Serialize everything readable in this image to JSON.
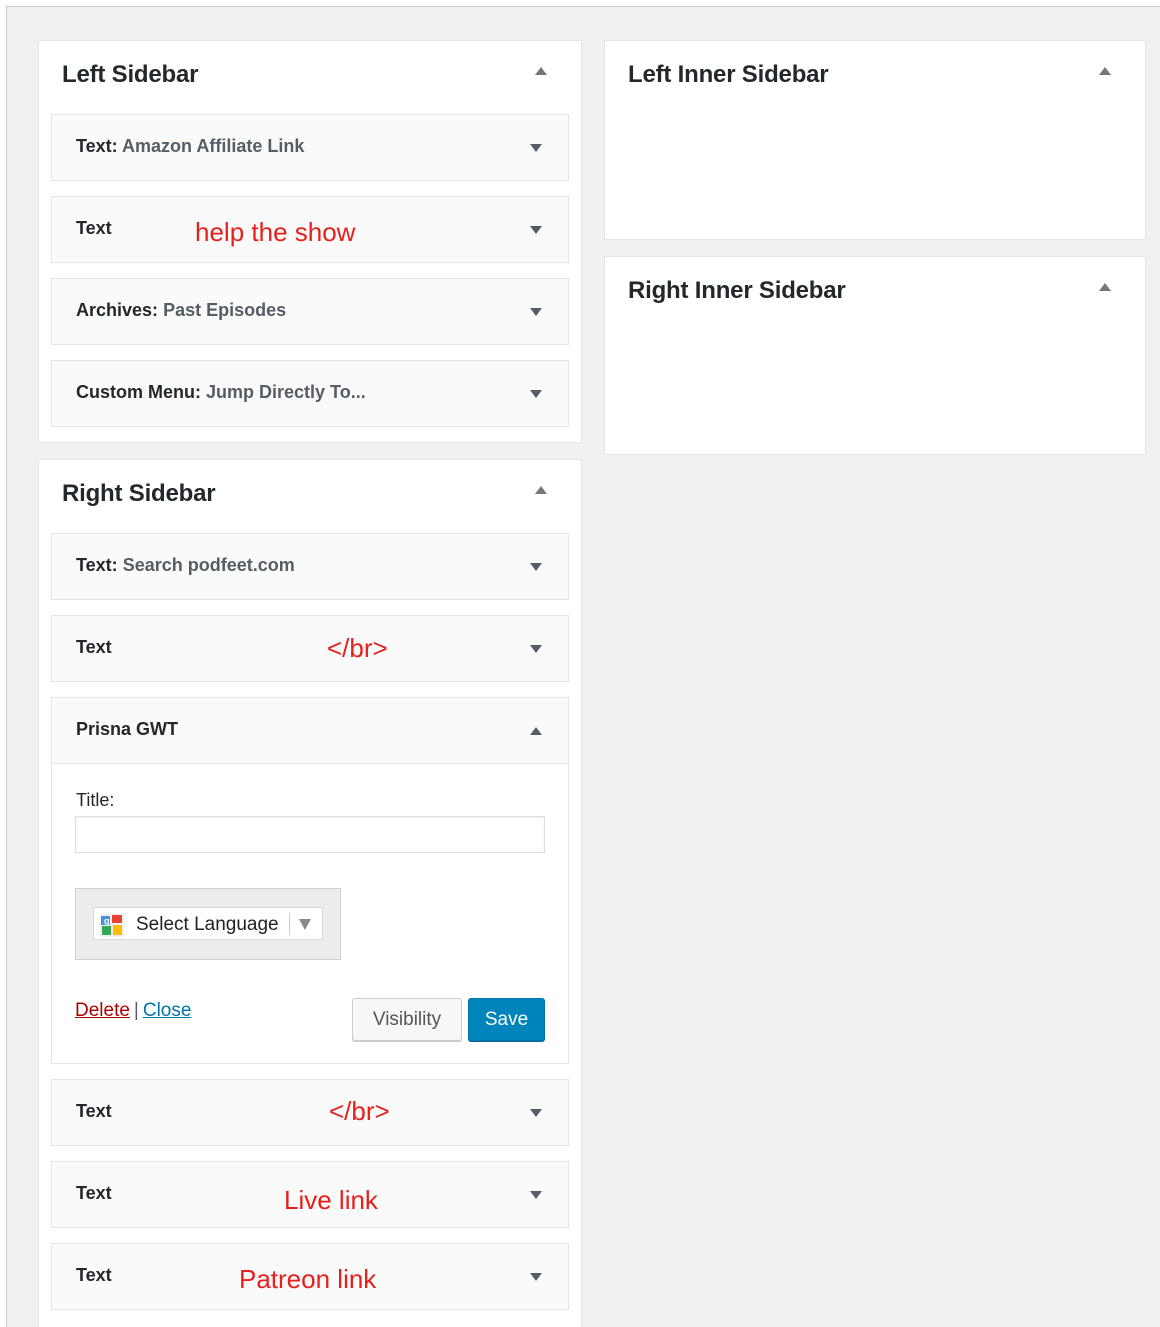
{
  "left_sidebar": {
    "title": "Left Sidebar",
    "widgets": [
      {
        "type": "Text:",
        "subtitle": "Amazon Affiliate Link",
        "annotation": ""
      },
      {
        "type": "Text",
        "subtitle": "",
        "annotation": "help the show"
      },
      {
        "type": "Archives:",
        "subtitle": "Past Episodes",
        "annotation": ""
      },
      {
        "type": "Custom Menu:",
        "subtitle": "Jump Directly To...",
        "annotation": ""
      }
    ]
  },
  "left_inner_sidebar": {
    "title": "Left Inner Sidebar"
  },
  "right_inner_sidebar": {
    "title": "Right Inner Sidebar"
  },
  "right_sidebar": {
    "title": "Right Sidebar",
    "widgets": [
      {
        "type": "Text:",
        "subtitle": "Search podfeet.com",
        "annotation": ""
      },
      {
        "type": "Text",
        "subtitle": "",
        "annotation": "</br>"
      },
      {
        "type": "Prisna GWT",
        "subtitle": "",
        "annotation": ""
      },
      {
        "type": "Text",
        "subtitle": "",
        "annotation": "</br>"
      },
      {
        "type": "Text",
        "subtitle": "",
        "annotation": "Live link"
      },
      {
        "type": "Text",
        "subtitle": "",
        "annotation": "Patreon link"
      }
    ],
    "prisna": {
      "title_label": "Title:",
      "title_value": "",
      "language_select": "Select Language",
      "delete_label": "Delete",
      "separator": "|",
      "close_label": "Close",
      "visibility_label": "Visibility",
      "save_label": "Save"
    }
  },
  "colors": {
    "background": "#f1f1f1",
    "annotation_red": "#e8201c",
    "save_button": "#0085ba",
    "delete_link": "#aa0000",
    "close_link": "#0073aa"
  }
}
